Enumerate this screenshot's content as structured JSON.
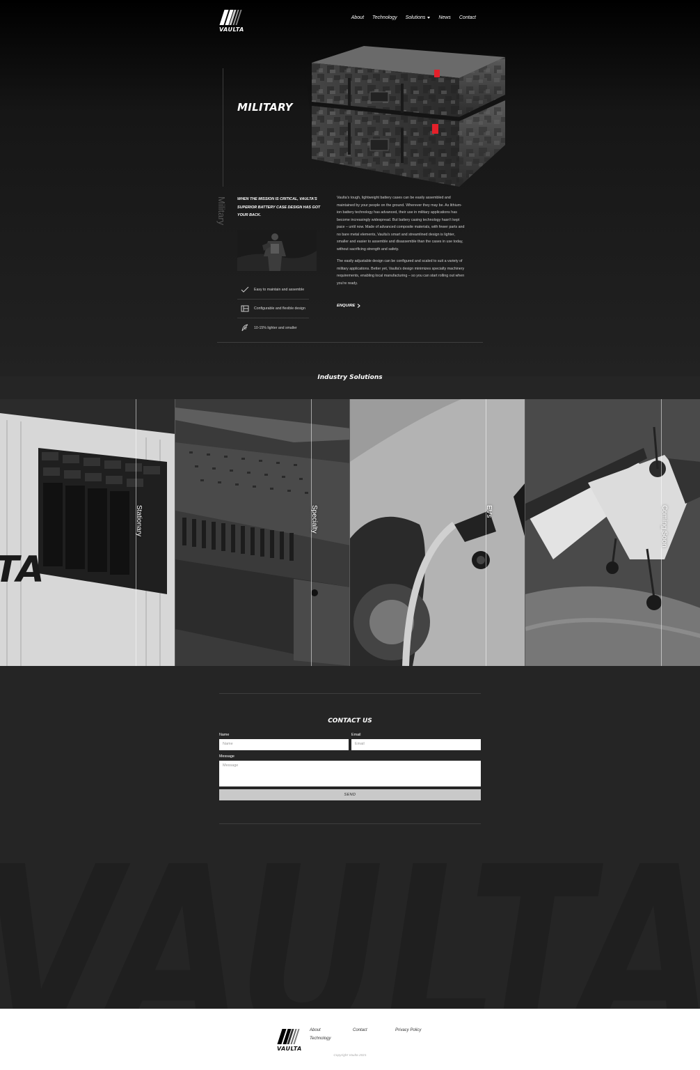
{
  "header": {
    "logo_text": "VAULTA",
    "nav": [
      {
        "label": "About"
      },
      {
        "label": "Technology"
      },
      {
        "label": "Solutions"
      },
      {
        "label": "News"
      },
      {
        "label": "Contact"
      }
    ]
  },
  "hero": {
    "title": "MILITARY",
    "side_label": "Military",
    "tagline": "When the mission is critical, Vaulta's superior battery case design has got your back.",
    "features": [
      {
        "icon": "check-icon",
        "label": "Easy to maintain and assemble"
      },
      {
        "icon": "layout-icon",
        "label": "Configurable and flexible design"
      },
      {
        "icon": "feather-icon",
        "label": "10-15% lighter and smaller"
      }
    ],
    "body": [
      "Vaulta's tough, lightweight battery cases can be easily assembled and maintained by your people on the ground. Wherever they may be. As lithium-ion battery technology has advanced, their use in military applications has become increasingly widespread. But battery casing technology hasn't kept pace – until now. Made of advanced composite materials, with fewer parts and no bare metal elements, Vaulta's smart and streamlined design is lighter, smaller and easier to assemble and disassemble than the cases in use today, without sacrificing strength and safety.",
      "The easily adjustable design can be configured and scaled to suit a variety of military applications. Better yet, Vaulta's design minimizes specialty machinery requirements, enabling local manufacturing – so you can start rolling out when you're ready."
    ],
    "cta": "ENQUIRE"
  },
  "industry": {
    "title": "Industry Solutions",
    "tiles": [
      {
        "label": "Stationary"
      },
      {
        "label": "Specialty"
      },
      {
        "label": "EVs"
      },
      {
        "label": "Coming Soon"
      }
    ]
  },
  "contact": {
    "title": "CONTACT US",
    "name_label": "Name",
    "name_placeholder": "Name",
    "email_label": "Email",
    "email_placeholder": "Email",
    "message_label": "Message",
    "message_placeholder": "Message",
    "send_label": "SEND"
  },
  "background_word": "VAULTA",
  "footer": {
    "logo_text": "VAULTA",
    "links_col1": [
      "About",
      "Technology"
    ],
    "links_col2": [
      "Contact"
    ],
    "links_col3": [
      "Privacy Policy"
    ],
    "copyright": "Copyright Vaulta 2021"
  }
}
